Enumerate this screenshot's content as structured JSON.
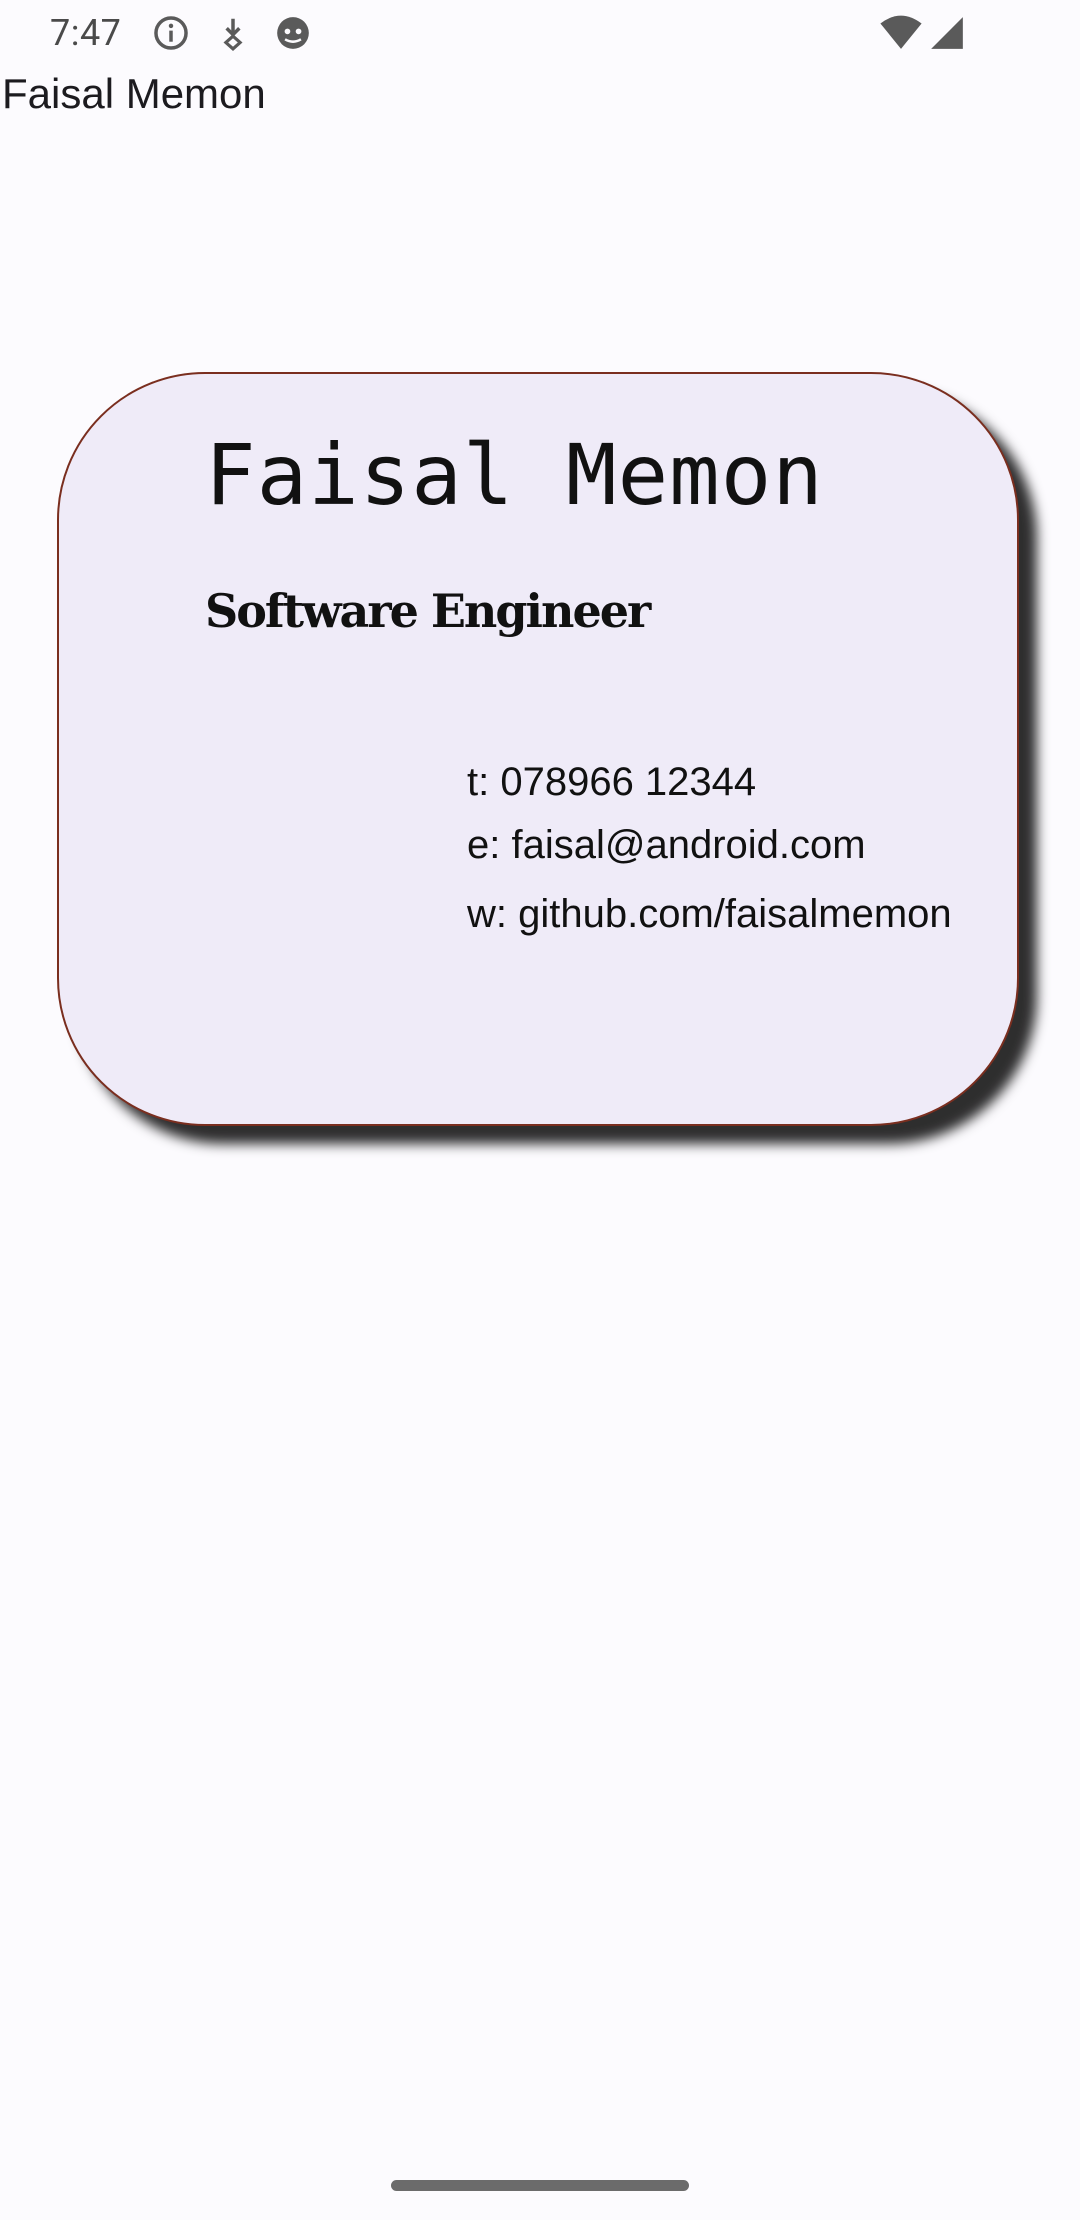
{
  "status_bar": {
    "time": "7:47",
    "icons": [
      "info-icon",
      "download-icon",
      "android-face-icon",
      "wifi-icon",
      "signal-icon"
    ]
  },
  "app": {
    "title": "Faisal Memon"
  },
  "card": {
    "name": "Faisal Memon",
    "role": "Software Engineer",
    "phone": "t: 078966 12344",
    "email": "e: faisal@android.com",
    "website": "w: github.com/faisalmemon",
    "background_color": "#efebf8",
    "border_color": "#7a2e1f"
  }
}
